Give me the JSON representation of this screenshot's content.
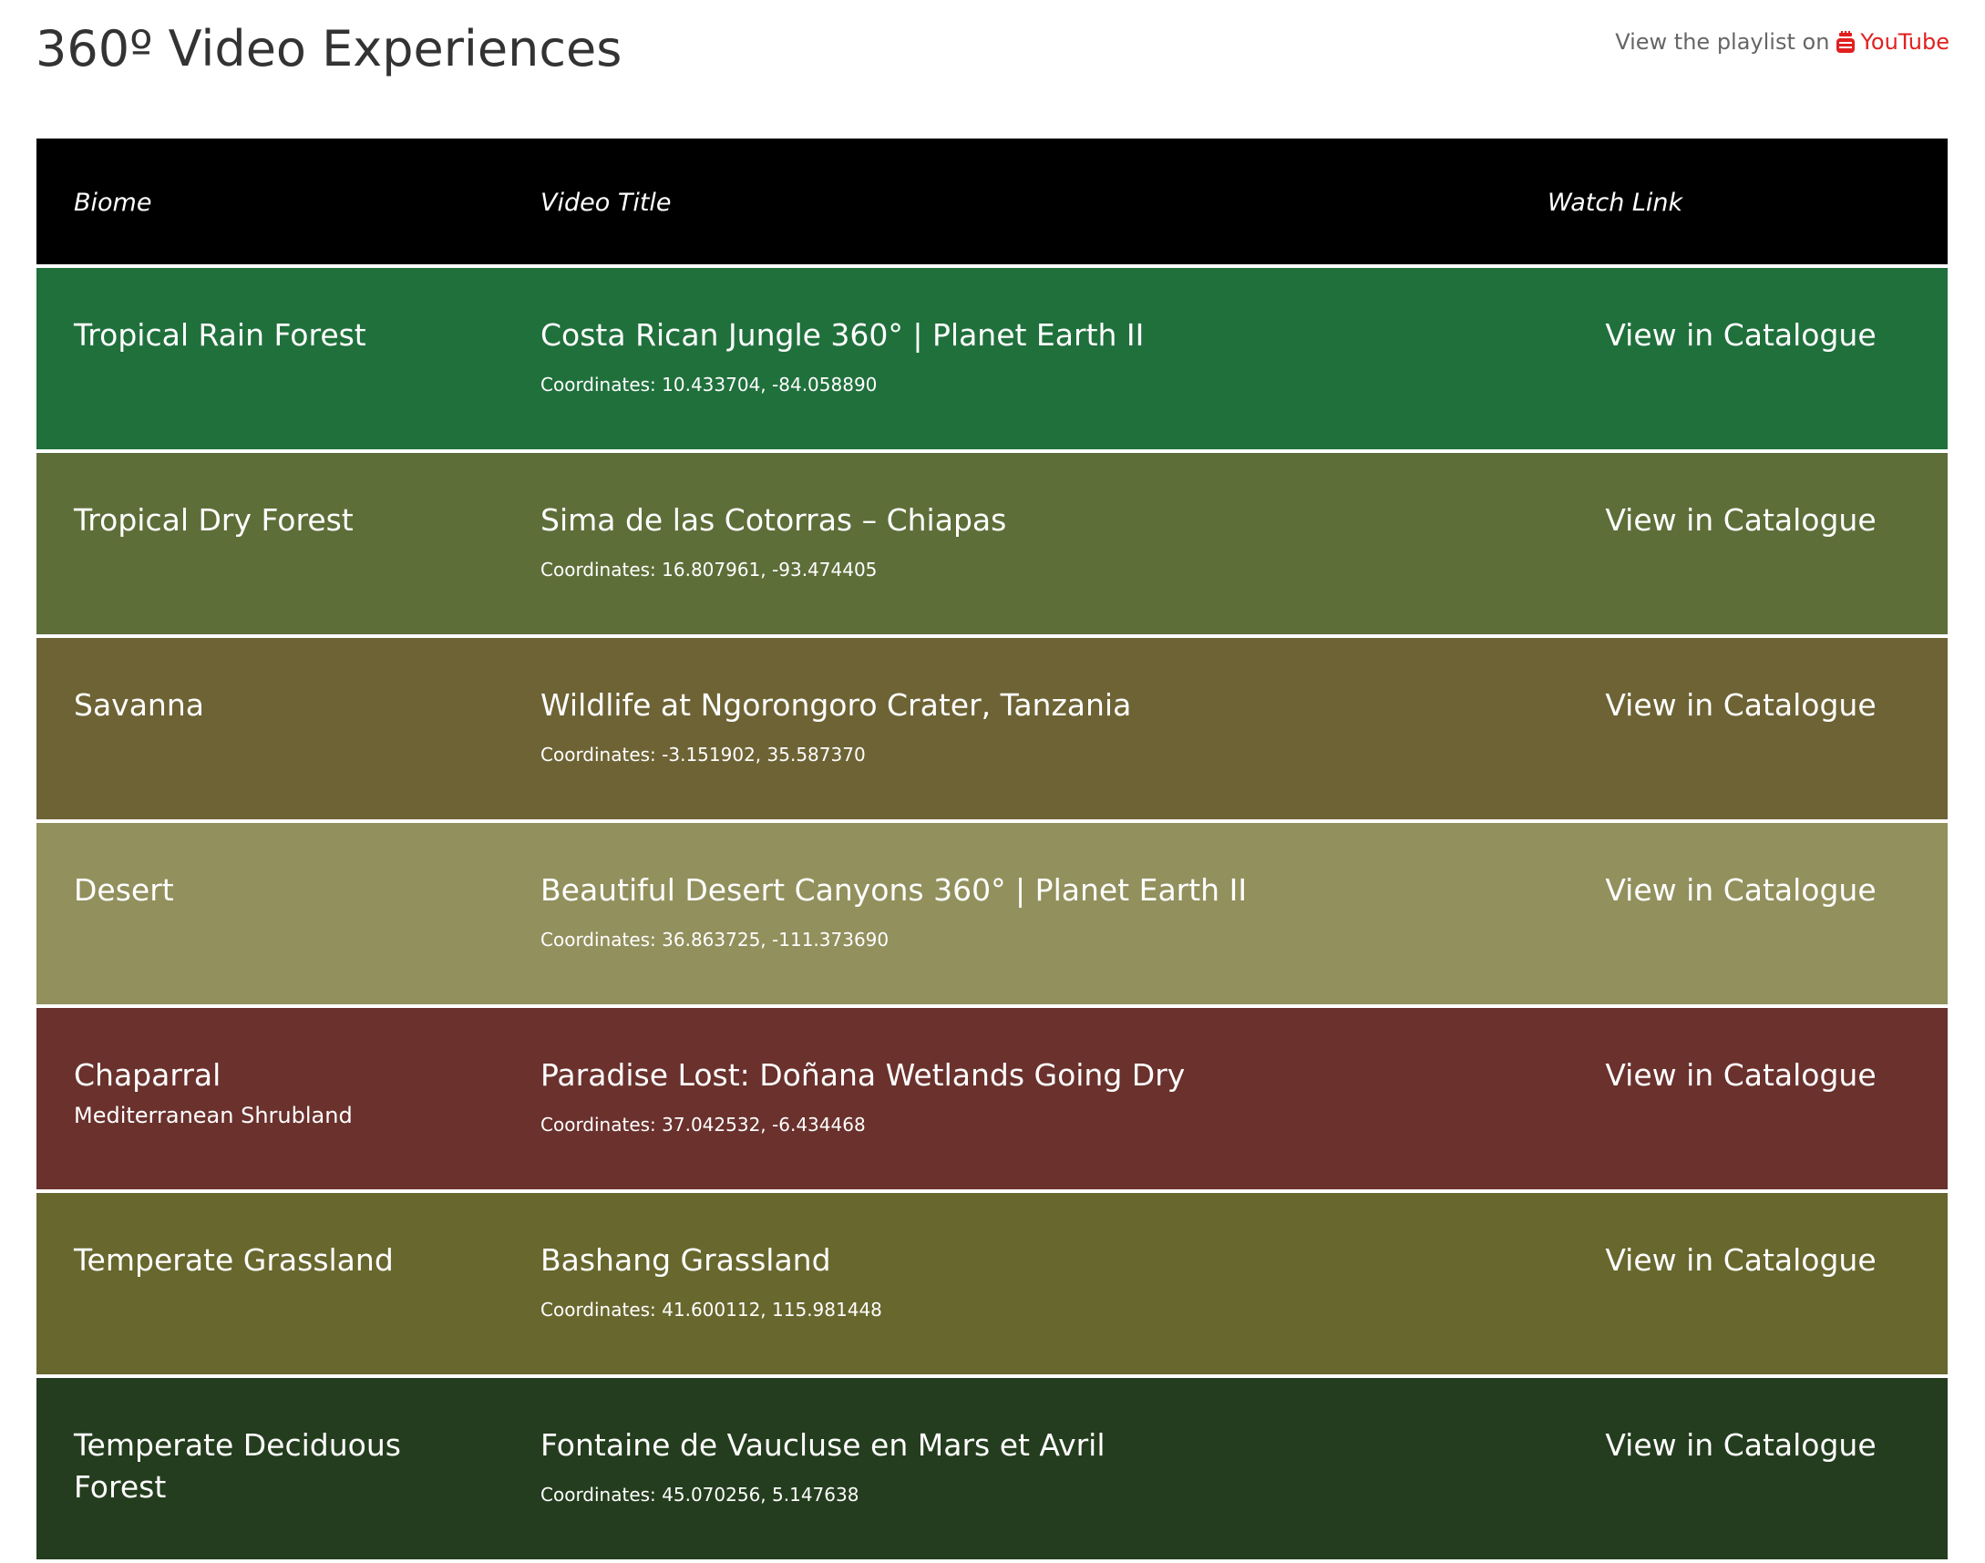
{
  "header": {
    "title": "360º Video Experiences",
    "playlist_prefix": "View the playlist on",
    "playlist_link": "YouTube",
    "playlist_icon": "youtube-icon",
    "link_color": "#e02020"
  },
  "table": {
    "columns": [
      "Biome",
      "Video Title",
      "Watch Link"
    ],
    "rows": [
      {
        "biome": "Tropical Rain Forest",
        "subtitle": "",
        "video_title": "Costa Rican Jungle 360° | Planet Earth II",
        "coordinates": "Coordinates: 10.433704, -84.058890",
        "link": "View in Catalogue",
        "color": "#20703c"
      },
      {
        "biome": "Tropical Dry Forest",
        "subtitle": "",
        "video_title": "Sima de las Cotorras – Chiapas",
        "coordinates": "Coordinates: 16.807961, -93.474405",
        "link": "View in Catalogue",
        "color": "#5e6e39"
      },
      {
        "biome": "Savanna",
        "subtitle": "",
        "video_title": "Wildlife at Ngorongoro Crater, Tanzania",
        "coordinates": "Coordinates: -3.151902, 35.587370",
        "link": "View in Catalogue",
        "color": "#6e6335"
      },
      {
        "biome": "Desert",
        "subtitle": "",
        "video_title": "Beautiful Desert Canyons 360° | Planet Earth II",
        "coordinates": "Coordinates: 36.863725, -111.373690",
        "link": "View in Catalogue",
        "color": "#92905d"
      },
      {
        "biome": "Chaparral",
        "subtitle": "Mediterranean Shrubland",
        "video_title": "Paradise Lost: Doñana Wetlands Going Dry",
        "coordinates": "Coordinates: 37.042532, -6.434468",
        "link": "View in Catalogue",
        "color": "#6a312d"
      },
      {
        "biome": "Temperate Grassland",
        "subtitle": "",
        "video_title": "Bashang Grassland",
        "coordinates": "Coordinates: 41.600112, 115.981448",
        "link": "View in Catalogue",
        "color": "#68672e"
      },
      {
        "biome": "Temperate Deciduous Forest",
        "subtitle": "",
        "video_title": "Fontaine de Vaucluse en Mars et Avril",
        "coordinates": "Coordinates: 45.070256, 5.147638",
        "link": "View in Catalogue",
        "color": "#243d1e"
      }
    ]
  }
}
